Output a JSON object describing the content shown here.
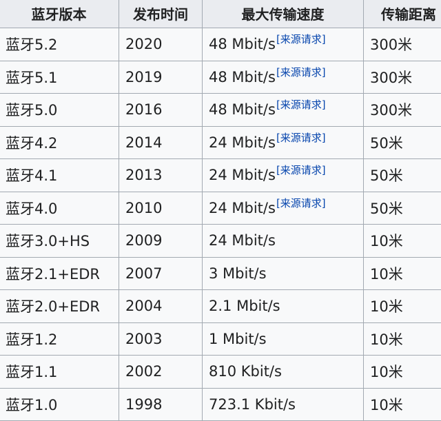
{
  "table": {
    "headers": [
      "蓝牙版本",
      "发布时间",
      "最大传输速度",
      "传输距离"
    ],
    "rows": [
      {
        "version": "蓝牙5.2",
        "year": "2020",
        "speed": "48 Mbit/s",
        "citation": "[来源请求]",
        "range": "300米"
      },
      {
        "version": "蓝牙5.1",
        "year": "2019",
        "speed": "48 Mbit/s",
        "citation": "[来源请求]",
        "range": "300米"
      },
      {
        "version": "蓝牙5.0",
        "year": "2016",
        "speed": "48 Mbit/s",
        "citation": "[来源请求]",
        "range": "300米"
      },
      {
        "version": "蓝牙4.2",
        "year": "2014",
        "speed": "24 Mbit/s",
        "citation": "[来源请求]",
        "range": "50米"
      },
      {
        "version": "蓝牙4.1",
        "year": "2013",
        "speed": "24 Mbit/s",
        "citation": "[来源请求]",
        "range": "50米"
      },
      {
        "version": "蓝牙4.0",
        "year": "2010",
        "speed": "24 Mbit/s",
        "citation": "[来源请求]",
        "range": "50米"
      },
      {
        "version": "蓝牙3.0+HS",
        "year": "2009",
        "speed": "24 Mbit/s",
        "citation": "",
        "range": "10米"
      },
      {
        "version": "蓝牙2.1+EDR",
        "year": "2007",
        "speed": "3 Mbit/s",
        "citation": "",
        "range": "10米"
      },
      {
        "version": "蓝牙2.0+EDR",
        "year": "2004",
        "speed": "2.1 Mbit/s",
        "citation": "",
        "range": "10米"
      },
      {
        "version": "蓝牙1.2",
        "year": "2003",
        "speed": "1 Mbit/s",
        "citation": "",
        "range": "10米"
      },
      {
        "version": "蓝牙1.1",
        "year": "2002",
        "speed": "810 Kbit/s",
        "citation": "",
        "range": "10米"
      },
      {
        "version": "蓝牙1.0",
        "year": "1998",
        "speed": "723.1 Kbit/s",
        "citation": "",
        "range": "10米"
      }
    ]
  },
  "colors": {
    "cell_background": "#f8f9fa",
    "header_background": "#eaecf0",
    "border": "#a2a9b1",
    "text": "#202122",
    "link": "#0645ad"
  }
}
